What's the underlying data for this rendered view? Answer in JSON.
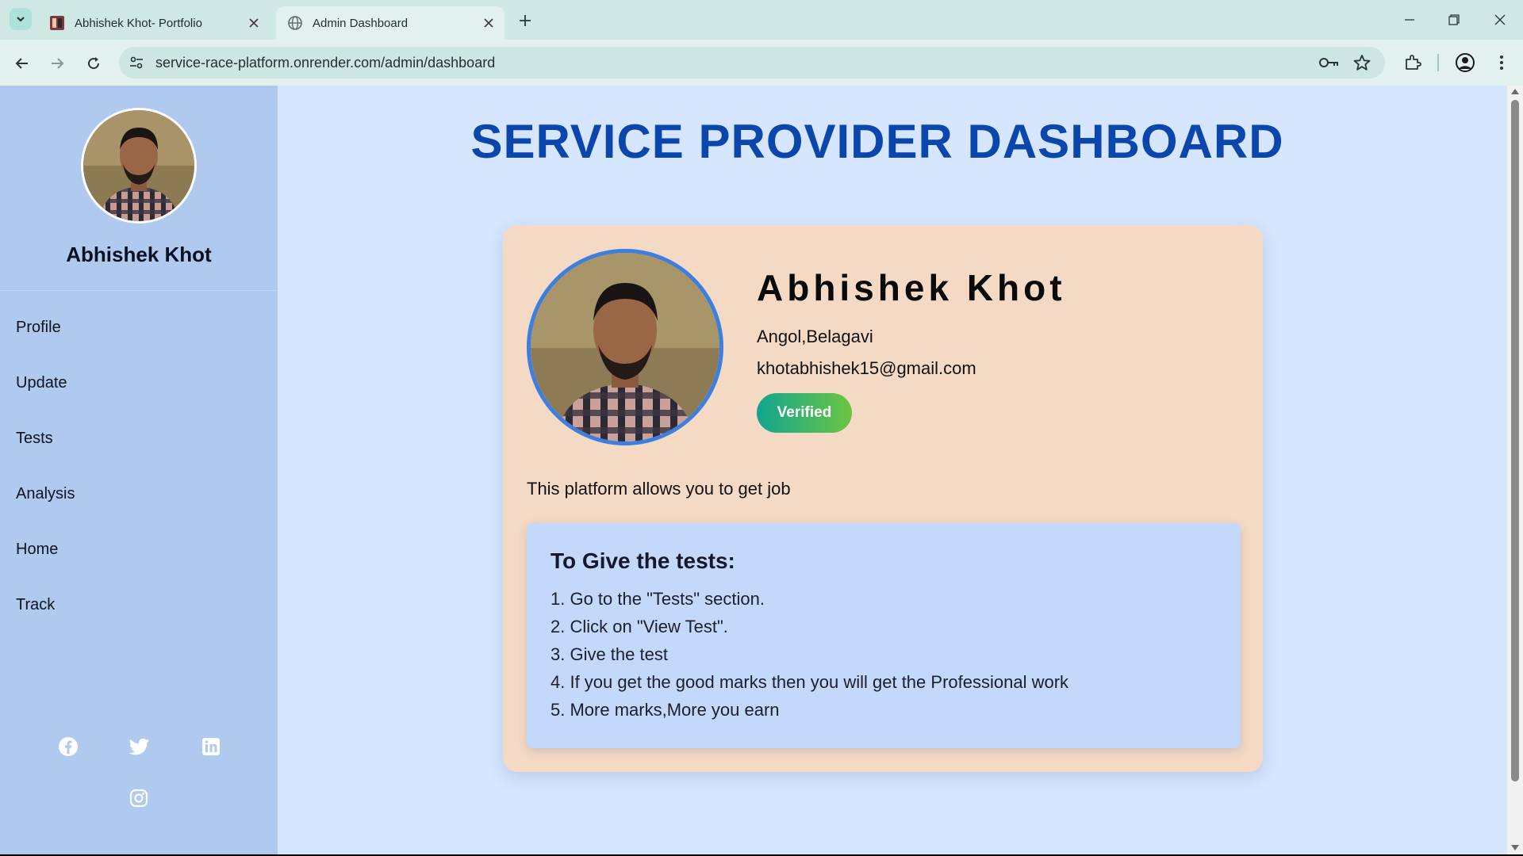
{
  "browser": {
    "tabs": [
      {
        "title": "Abhishek Khot- Portfolio",
        "active": false
      },
      {
        "title": "Admin Dashboard",
        "active": true
      }
    ],
    "url": "service-race-platform.onrender.com/admin/dashboard",
    "icons": [
      "tab-search-icon",
      "close-icon",
      "new-tab-icon",
      "minimize-icon",
      "restore-icon",
      "back-icon",
      "forward-icon",
      "reload-icon",
      "site-info-icon",
      "key-icon",
      "star-icon",
      "extensions-icon",
      "profile-icon",
      "more-icon"
    ]
  },
  "sidebar": {
    "name": "Abhishek Khot",
    "menu": [
      "Profile",
      "Update",
      "Tests",
      "Analysis",
      "Home",
      "Track"
    ],
    "social": [
      "facebook-icon",
      "twitter-icon",
      "linkedin-icon",
      "instagram-icon"
    ]
  },
  "main": {
    "title": "SERVICE PROVIDER DASHBOARD",
    "profile": {
      "name": "Abhishek Khot",
      "location": "Angol,Belagavi",
      "email": "khotabhishek15@gmail.com",
      "badge": "Verified"
    },
    "description": "This platform allows you to get job",
    "instructions": {
      "title": "To Give the tests:",
      "steps": [
        "1. Go to the \"Tests\" section.",
        "2. Click on \"View Test\".",
        "3. Give the test",
        "4. If you get the good marks then you will get the Professional work",
        "5. More marks,More you earn"
      ]
    }
  },
  "colors": {
    "title_blue": "#0b46ad",
    "sidebar_bg": "#afc9ef",
    "page_bg": "#d6e6ff",
    "card_bg": "#f4d9c4",
    "instructions_bg": "#c4d8fb",
    "avatar_border": "#3b7fe0",
    "badge_gradient_start": "#11a58f",
    "badge_gradient_end": "#6cc541"
  }
}
